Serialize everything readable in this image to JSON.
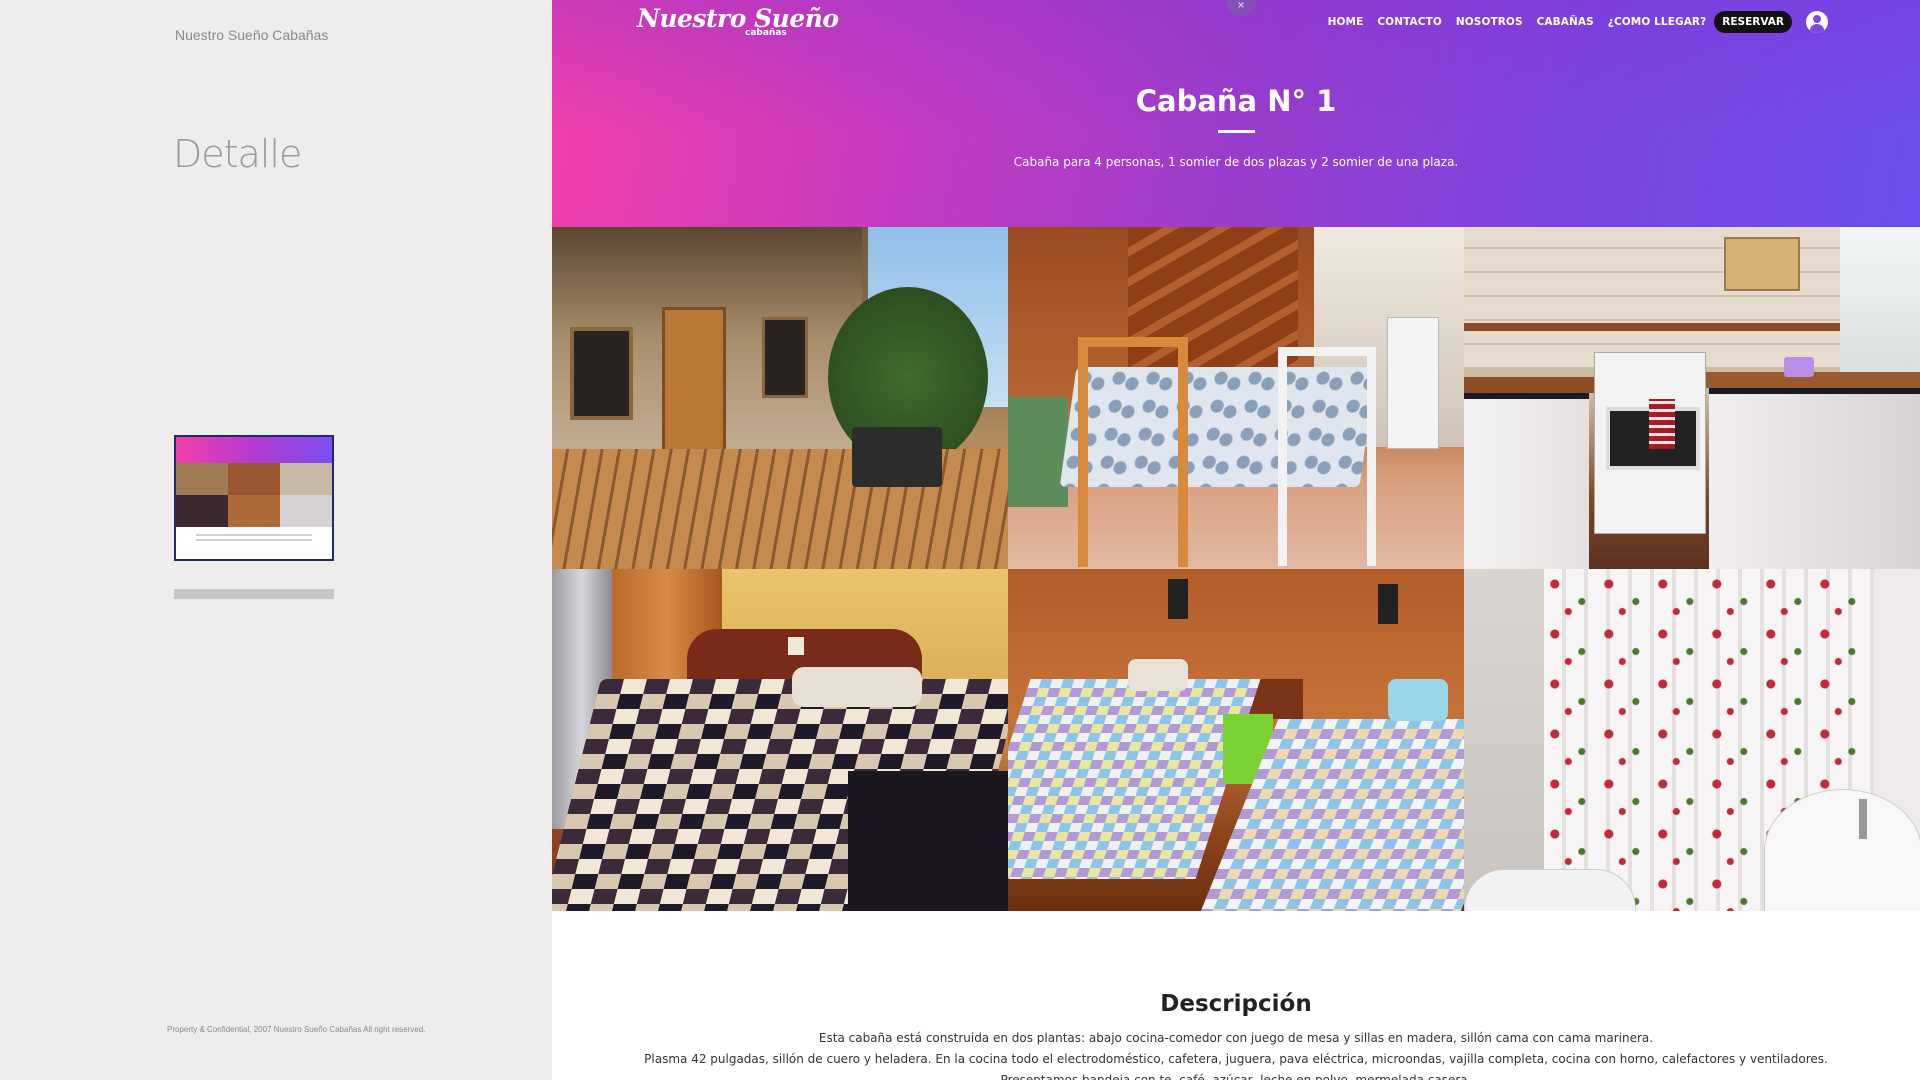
{
  "left_panel": {
    "brand": "Nuestro Sueño Cabañas",
    "section_title": "Detalle",
    "copyright": "Property & Confidential, 2007 Nuestro Sueño Cabañas All right reserved."
  },
  "header": {
    "logo": "Nuestro Sueño",
    "logo_sub": "cabañas",
    "close_symbol": "×",
    "nav": [
      "HOME",
      "CONTACTO",
      "NOSOTROS",
      "CABAÑAS",
      "¿COMO LLEGAR?"
    ],
    "reserve_label": "RESERVAR",
    "user_icon": "user-icon"
  },
  "hero": {
    "title": "Cabaña N° 1",
    "subtitle": "Cabaña para 4 personas, 1 somier de dos plazas y 2 somier de una plaza.",
    "gradient": [
      "#f43fa9",
      "#9b3ccd",
      "#6d4ef0"
    ]
  },
  "gallery": {
    "photos": [
      "terrace-photo",
      "dining-photo",
      "kitchen-photo",
      "double-bed-photo",
      "twin-beds-photo",
      "bathroom-photo"
    ]
  },
  "description": {
    "title": "Descripción",
    "lines": [
      "Esta cabaña está construida en dos plantas: abajo cocina-comedor con juego de mesa y sillas en madera, sillón cama con cama marinera.",
      "Plasma 42 pulgadas, sillón de cuero y heladera. En la cocina todo el electrodoméstico, cafetera, juguera, pava eléctrica, microondas, vajilla completa, cocina con horno, calefactores y ventiladores.",
      "Presentamos bandeja con te, café, azúcar, leche en polvo, mermelada casera."
    ]
  }
}
